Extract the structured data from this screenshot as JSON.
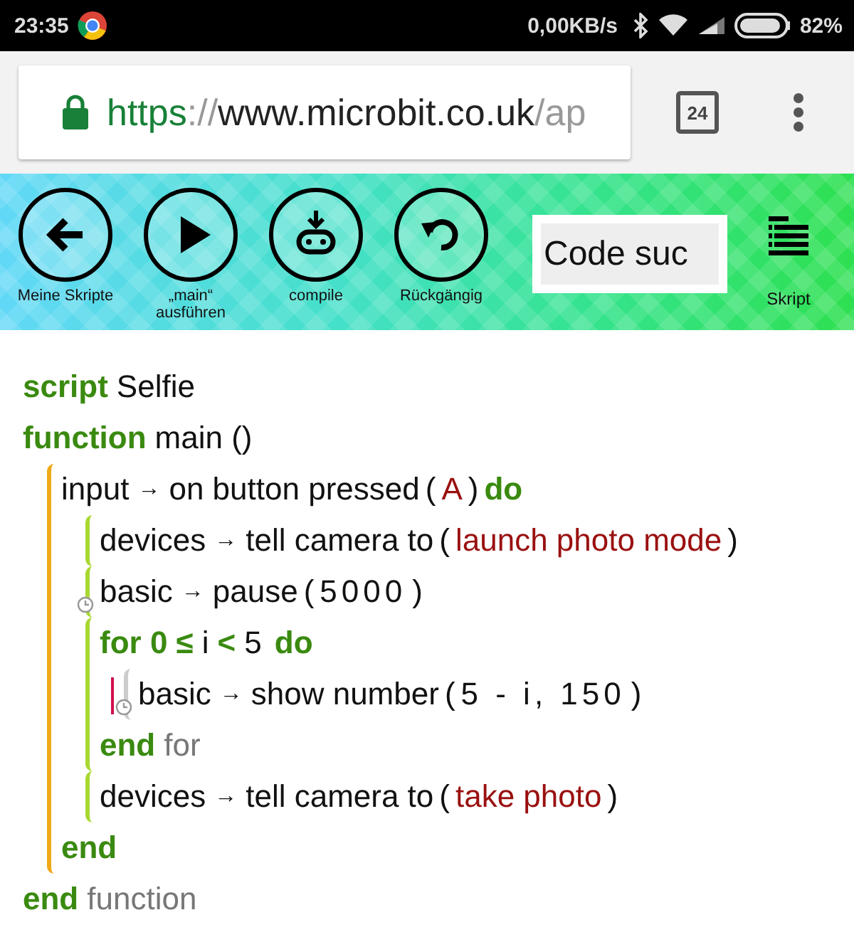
{
  "status_bar": {
    "time": "23:35",
    "speed": "0,00KB/s",
    "battery": "82%"
  },
  "browser": {
    "url": {
      "scheme": "https",
      "separator": "://",
      "host": "www.microbit.co.uk",
      "path": "/ap"
    },
    "tab_count": "24"
  },
  "toolbar": {
    "buttons": [
      {
        "kind": "back",
        "label": "Meine Skripte"
      },
      {
        "kind": "run",
        "label": "„main“\nausführen"
      },
      {
        "kind": "compile",
        "label": "compile"
      },
      {
        "kind": "undo",
        "label": "Rückgängig"
      }
    ],
    "search": {
      "placeholder": "Code suc"
    },
    "script_button": {
      "label": "Skript"
    }
  },
  "code": [
    {
      "kind": "line",
      "tokens": [
        {
          "kind": "keyword",
          "text": "script"
        },
        {
          "kind": "name",
          "text": "Selfie"
        }
      ]
    },
    {
      "kind": "line",
      "tokens": [
        {
          "kind": "keyword",
          "text": "function"
        },
        {
          "kind": "name",
          "text": "main ()"
        }
      ]
    },
    {
      "kind": "block",
      "timed": false,
      "flagged": false,
      "children": [
        {
          "kind": "line",
          "tokens": [
            {
              "kind": "name",
              "text": "input"
            },
            {
              "kind": "arrow",
              "text": "→"
            },
            {
              "kind": "name",
              "text": "on button pressed"
            },
            {
              "kind": "punct",
              "text": "("
            },
            {
              "kind": "arg",
              "text": "A"
            },
            {
              "kind": "punct",
              "text": ")"
            },
            {
              "kind": "keyword",
              "text": "do"
            }
          ]
        },
        {
          "kind": "block",
          "timed": false,
          "flagged": false,
          "children": [
            {
              "kind": "line",
              "tokens": [
                {
                  "kind": "name",
                  "text": "devices"
                },
                {
                  "kind": "arrow",
                  "text": "→"
                },
                {
                  "kind": "name",
                  "text": "tell camera to"
                },
                {
                  "kind": "punct",
                  "text": "("
                },
                {
                  "kind": "arg",
                  "text": "launch photo mode"
                },
                {
                  "kind": "punct",
                  "text": ")"
                }
              ]
            }
          ]
        },
        {
          "kind": "block",
          "timed": true,
          "flagged": false,
          "children": [
            {
              "kind": "line",
              "tokens": [
                {
                  "kind": "name",
                  "text": "basic"
                },
                {
                  "kind": "arrow",
                  "text": "→"
                },
                {
                  "kind": "name",
                  "text": "pause"
                },
                {
                  "kind": "punct",
                  "text": "("
                },
                {
                  "kind": "number",
                  "text": "5000"
                },
                {
                  "kind": "punct",
                  "text": ")"
                }
              ]
            }
          ]
        },
        {
          "kind": "block",
          "timed": false,
          "flagged": false,
          "children": [
            {
              "kind": "line",
              "tokens": [
                {
                  "kind": "keyword",
                  "text": "for 0 ≤"
                },
                {
                  "kind": "name",
                  "text": "i"
                },
                {
                  "kind": "keyword",
                  "text": "<"
                },
                {
                  "kind": "number",
                  "text": "5"
                },
                {
                  "kind": "keyword",
                  "text": "do"
                }
              ]
            },
            {
              "kind": "block",
              "timed": true,
              "flagged": true,
              "children": [
                {
                  "kind": "line",
                  "tokens": [
                    {
                      "kind": "name",
                      "text": "basic"
                    },
                    {
                      "kind": "arrow",
                      "text": "→"
                    },
                    {
                      "kind": "name",
                      "text": "show number"
                    },
                    {
                      "kind": "punct",
                      "text": "("
                    },
                    {
                      "kind": "number",
                      "text": "5 - i, 150"
                    },
                    {
                      "kind": "punct",
                      "text": ")"
                    }
                  ]
                }
              ]
            },
            {
              "kind": "line",
              "tokens": [
                {
                  "kind": "keyword",
                  "text": "end"
                },
                {
                  "kind": "dim",
                  "text": "for"
                }
              ]
            }
          ]
        },
        {
          "kind": "block",
          "timed": false,
          "flagged": false,
          "children": [
            {
              "kind": "line",
              "tokens": [
                {
                  "kind": "name",
                  "text": "devices"
                },
                {
                  "kind": "arrow",
                  "text": "→"
                },
                {
                  "kind": "name",
                  "text": "tell camera to"
                },
                {
                  "kind": "punct",
                  "text": "("
                },
                {
                  "kind": "arg",
                  "text": "take photo"
                },
                {
                  "kind": "punct",
                  "text": ")"
                }
              ]
            }
          ]
        },
        {
          "kind": "line",
          "tokens": [
            {
              "kind": "keyword",
              "text": "end"
            }
          ]
        }
      ]
    },
    {
      "kind": "line",
      "tokens": [
        {
          "kind": "keyword",
          "text": "end"
        },
        {
          "kind": "dim",
          "text": "function"
        }
      ]
    }
  ]
}
